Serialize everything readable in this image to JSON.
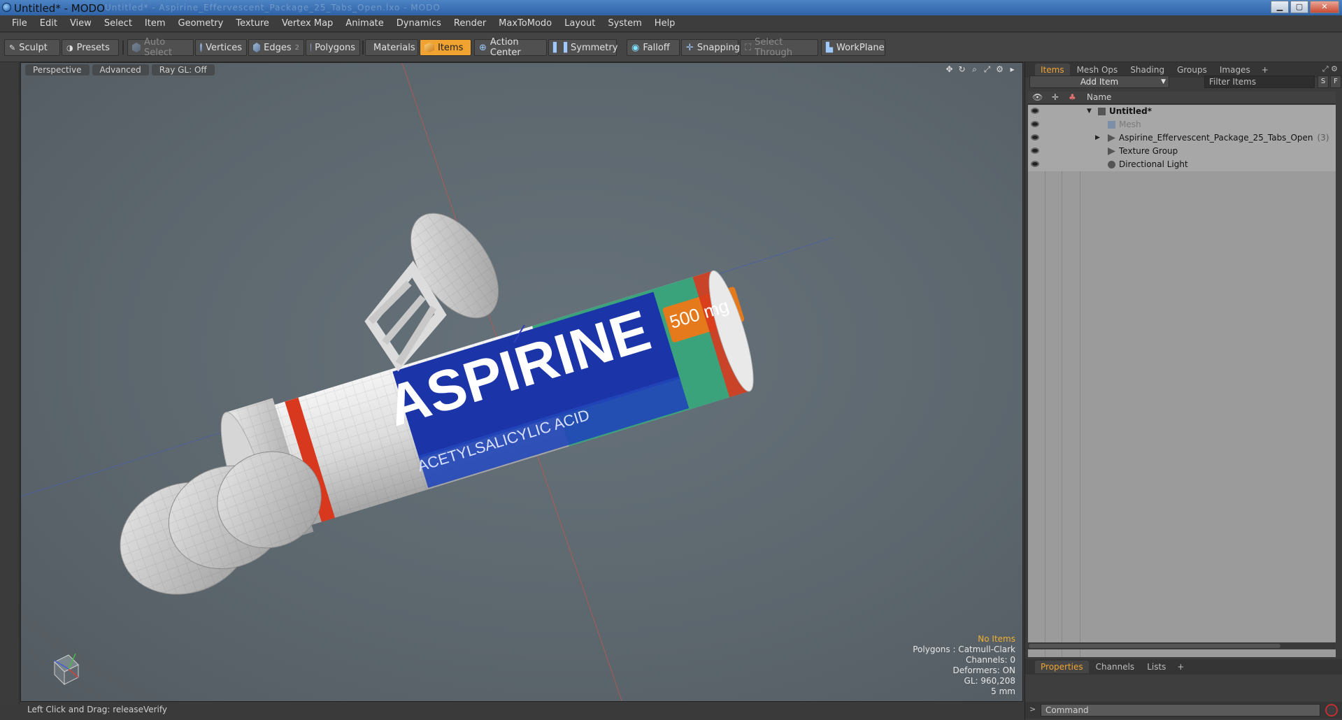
{
  "window": {
    "title": "Untitled* - MODO",
    "ghost_title": "Untitled* - Aspirine_Effervescent_Package_25_Tabs_Open.lxo - MODO"
  },
  "menubar": [
    "File",
    "Edit",
    "View",
    "Select",
    "Item",
    "Geometry",
    "Texture",
    "Vertex Map",
    "Animate",
    "Dynamics",
    "Render",
    "MaxToModo",
    "Layout",
    "System",
    "Help"
  ],
  "toolbar": {
    "sculpt": "Sculpt",
    "presets": "Presets",
    "auto_select": "Auto Select",
    "vertices": "Vertices",
    "edges": "Edges",
    "edges_count": "2",
    "polygons": "Polygons",
    "materials": "Materials",
    "items": "Items",
    "action_center": "Action Center",
    "symmetry": "Symmetry",
    "falloff": "Falloff",
    "snapping": "Snapping",
    "select_through": "Select Through",
    "workplane": "WorkPlane"
  },
  "viewport": {
    "tabs": [
      "Perspective",
      "Advanced",
      "Ray GL: Off"
    ],
    "info": {
      "selection": "No Items",
      "polygons": "Polygons : Catmull-Clark",
      "channels": "Channels: 0",
      "deformers": "Deformers: ON",
      "gl": "GL: 960,208",
      "scale": "5 mm"
    },
    "label_main": "ASPIRINE",
    "label_sub": "ACETYLSALICYLIC ACID",
    "label_dose": "500 mg"
  },
  "statusbar": {
    "text": "Left Click and Drag:  releaseVerify"
  },
  "items_panel": {
    "tabs": [
      "Items",
      "Mesh Ops",
      "Shading",
      "Groups",
      "Images"
    ],
    "active_tab": "Items",
    "add_item": "Add Item",
    "filter_placeholder": "Filter Items",
    "btn_s": "S",
    "btn_f": "F",
    "col_name": "Name",
    "rows": [
      {
        "label": "Untitled*",
        "bold": true
      },
      {
        "label": "Mesh",
        "dim": true
      },
      {
        "label": "Aspirine_Effervescent_Package_25_Tabs_Open",
        "count": "(3)"
      },
      {
        "label": "Texture Group"
      },
      {
        "label": "Directional Light"
      }
    ]
  },
  "properties_panel": {
    "tabs": [
      "Properties",
      "Channels",
      "Lists"
    ],
    "active_tab": "Properties"
  },
  "command": {
    "placeholder": "Command"
  },
  "colors": {
    "accent": "#f0a330",
    "viewport_bg": "#5f6a71",
    "label_blue": "#1b34a8",
    "label_green": "#3aa37c",
    "label_red": "#d8381e",
    "label_orange": "#e47a1c"
  }
}
